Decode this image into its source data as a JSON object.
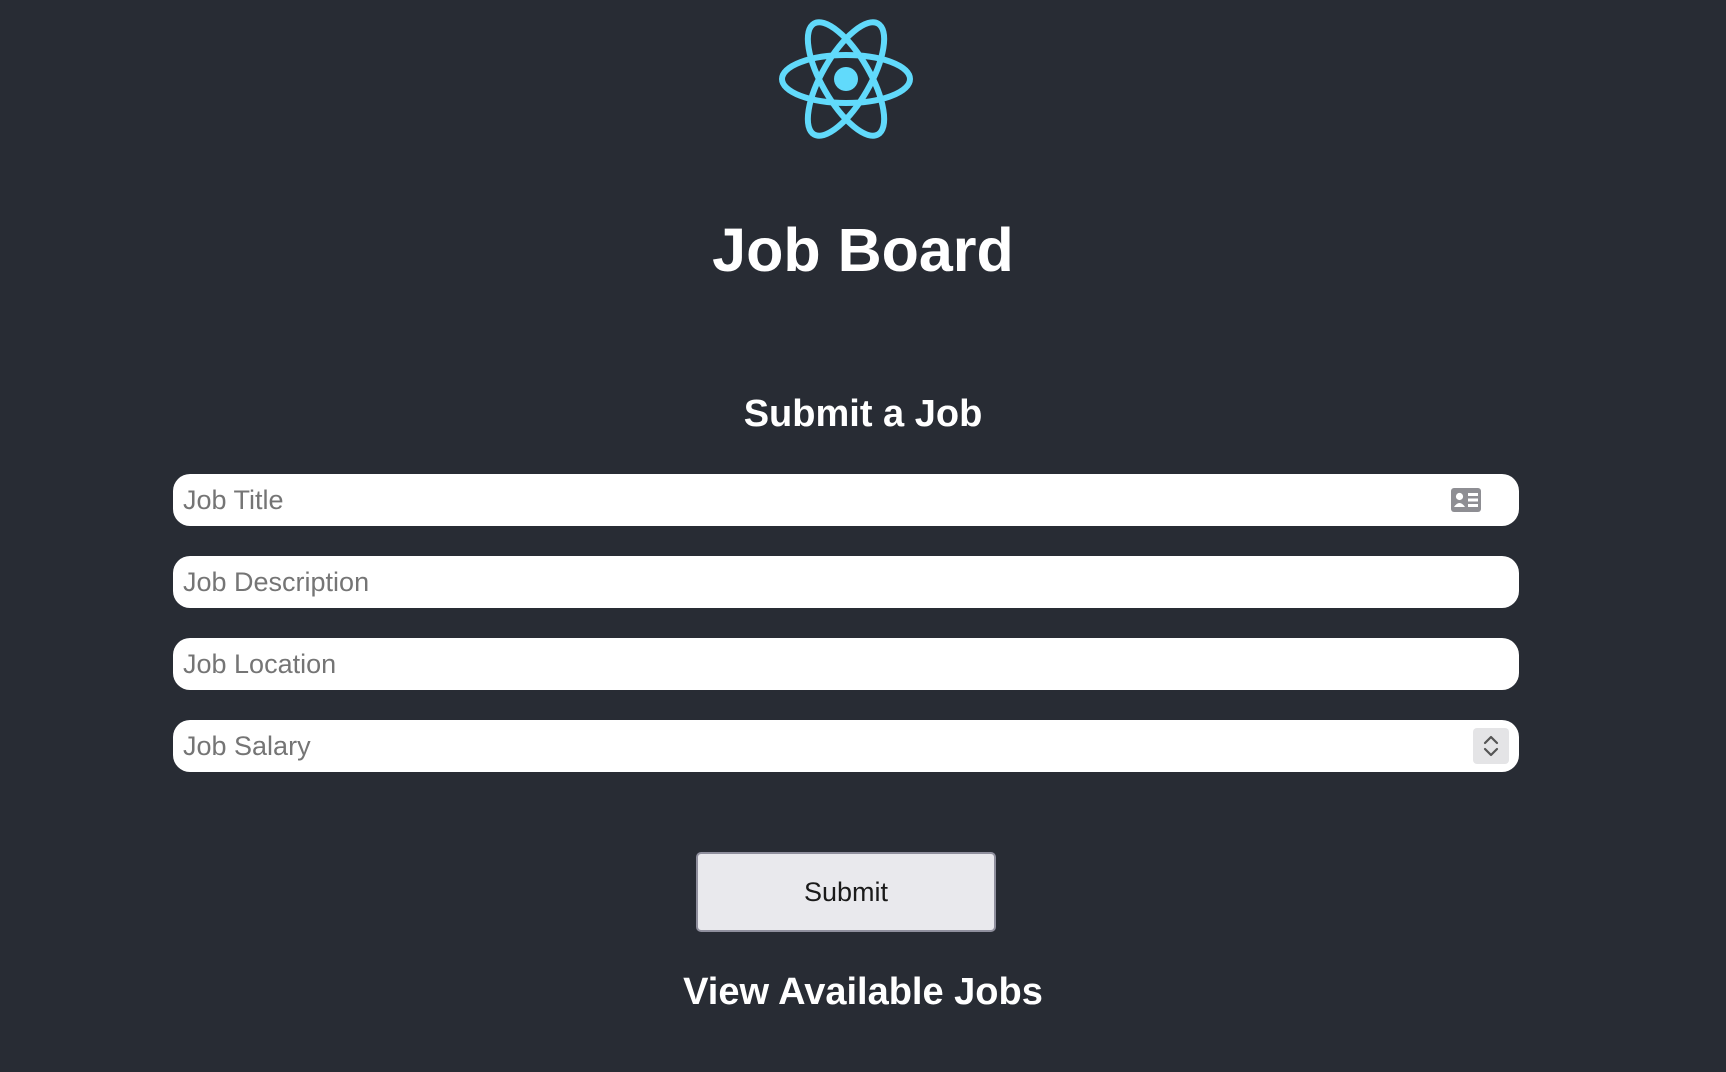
{
  "app": {
    "title": "Job Board",
    "logo_icon": "react-atom-logo-icon",
    "accent_color": "#61dafb",
    "background_color": "#282c34"
  },
  "form": {
    "heading": "Submit a Job",
    "fields": [
      {
        "placeholder": "Job Title",
        "value": "",
        "icon": "contact-card-icon"
      },
      {
        "placeholder": "Job Description",
        "value": ""
      },
      {
        "placeholder": "Job Location",
        "value": ""
      },
      {
        "placeholder": "Job Salary",
        "value": "",
        "icon": "number-stepper-icon"
      }
    ],
    "submit_label": "Submit"
  },
  "jobs": {
    "heading": "View Available Jobs"
  }
}
